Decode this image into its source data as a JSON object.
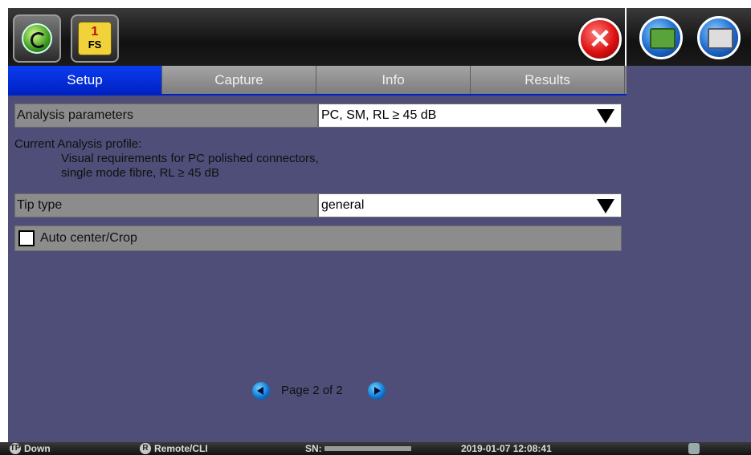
{
  "header": {
    "fs_number": "1",
    "fs_label": "FS"
  },
  "tabs": [
    {
      "label": "Setup",
      "active": true
    },
    {
      "label": "Capture",
      "active": false
    },
    {
      "label": "Info",
      "active": false
    },
    {
      "label": "Results",
      "active": false
    }
  ],
  "setup": {
    "analysis": {
      "label": "Analysis parameters",
      "value": "PC, SM, RL ≥ 45 dB"
    },
    "profile": {
      "heading": "Current Analysis profile:",
      "line1": "Visual requirements for PC polished connectors,",
      "line2": "single mode fibre, RL ≥ 45 dB"
    },
    "tip_type": {
      "label": "Tip type",
      "value": "general"
    },
    "auto_center": {
      "label": "Auto center/Crop",
      "checked": false
    }
  },
  "pager": {
    "text": "Page 2 of 2",
    "current": 2,
    "total": 2
  },
  "status_bar": {
    "tp_icon": "TP",
    "tp_status": "Down",
    "r_icon": "R",
    "remote_status": "Remote/CLI",
    "sn_label": "SN:",
    "datetime": "2019-01-07 12:08:41"
  },
  "icons": {
    "home": "fiberscope-home-icon",
    "close": "close-x-icon",
    "save": "save-icon",
    "export": "export-icon",
    "prev": "prev-page-icon",
    "next": "next-page-icon"
  },
  "colors": {
    "active_tab": "#0022c4",
    "panel_bg": "#4e4e78",
    "close_red": "#d11111",
    "badge_yellow": "#f2d23a"
  }
}
